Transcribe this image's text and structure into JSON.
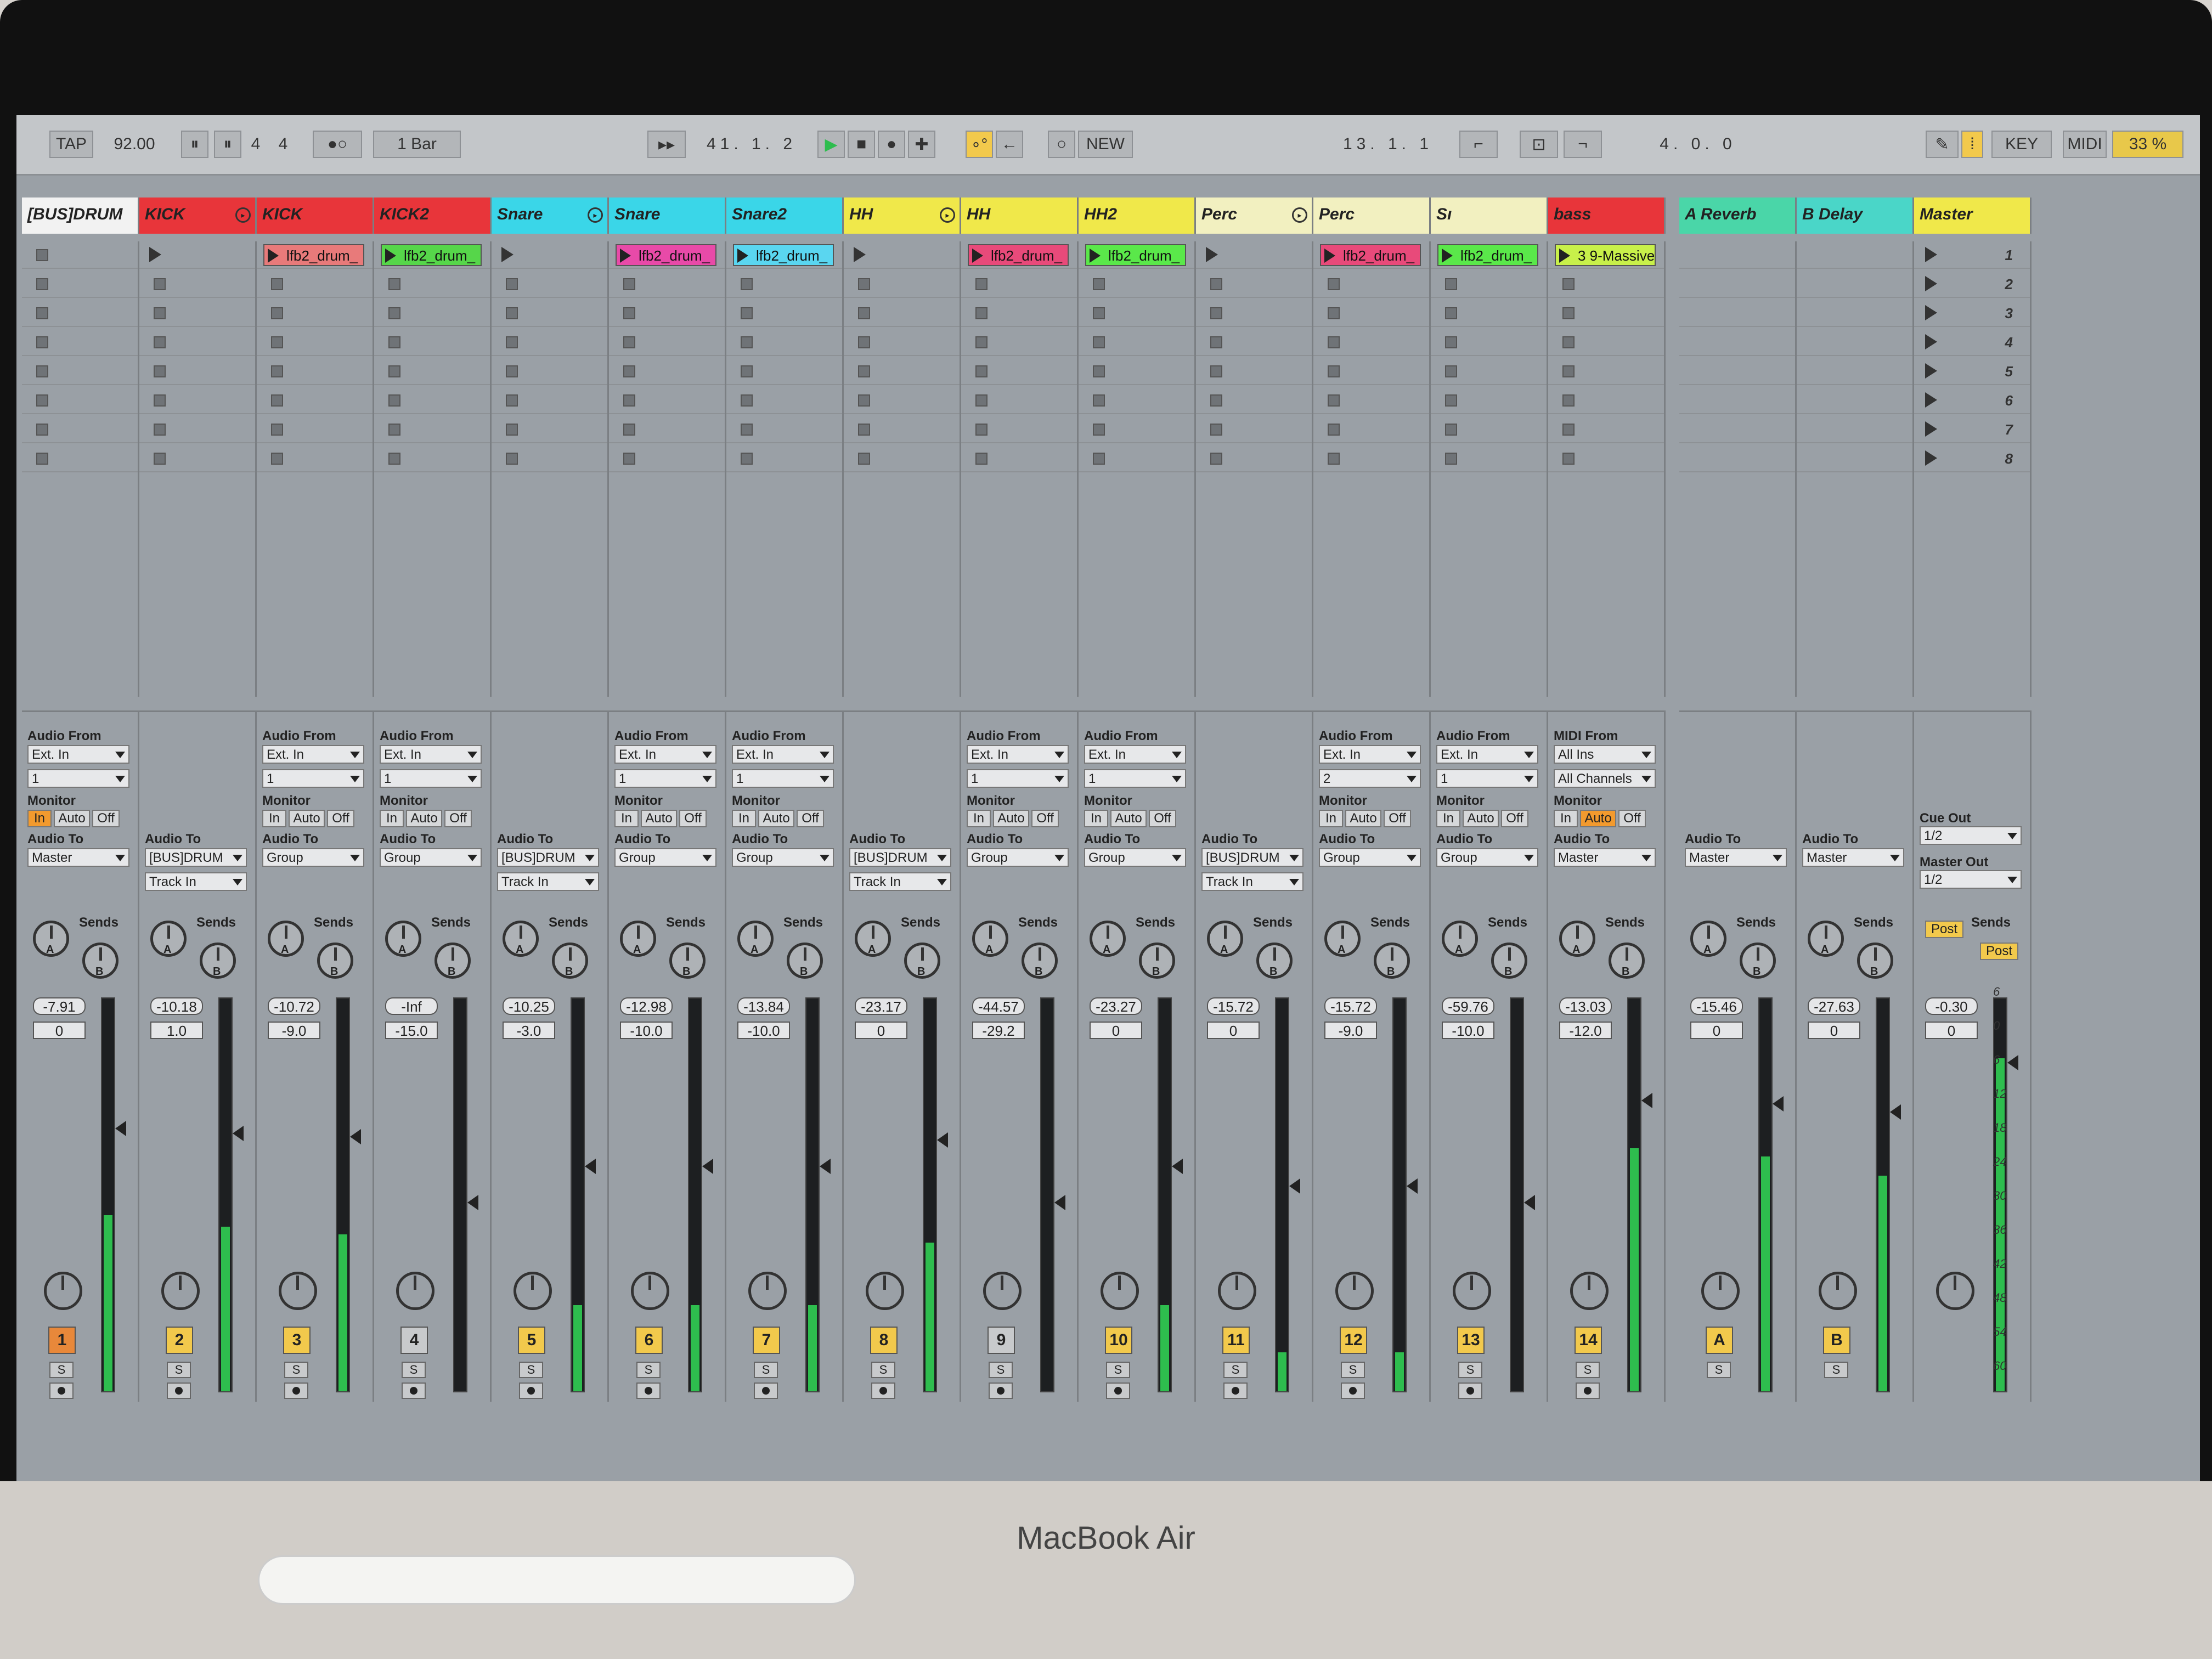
{
  "device": {
    "brand": "MacBook Air"
  },
  "transport": {
    "tap": "TAP",
    "tempo": "92.00",
    "sig_num": "4",
    "sig_den": "4",
    "quantize": "1 Bar",
    "position": "41. 1. 2",
    "new_label": "NEW",
    "loop_start": "13. 1. 1",
    "loop_length": "4. 0. 0",
    "key_label": "KEY",
    "midi_label": "MIDI",
    "cpu": "33 %"
  },
  "tracks": [
    {
      "name": "[BUS]DRUM",
      "color": "#f2f2f2",
      "clip": "",
      "clip_color": "",
      "audio_from": "Ext. In",
      "input_ch": "1",
      "monitor": "In",
      "audio_to": "Master",
      "track_in": "",
      "vol": "-7.91",
      "pan": "0",
      "num": "1",
      "num_color": "#e8883a",
      "meter": 0.45
    },
    {
      "name": "KICK",
      "color": "#e8353a",
      "clip": "",
      "clip_color": "",
      "audio_from": "",
      "input_ch": "",
      "monitor": "",
      "audio_to": "[BUS]DRUM",
      "track_in": "Track In",
      "vol": "-10.18",
      "pan": "1.0",
      "num": "2",
      "num_color": "#f2c94c",
      "meter": 0.42
    },
    {
      "name": "KICK",
      "color": "#e8353a",
      "clip": "lfb2_drum_",
      "clip_color": "#e87a7a",
      "audio_from": "Ext. In",
      "input_ch": "1",
      "monitor": "Auto",
      "audio_to": "Group",
      "track_in": "",
      "vol": "-10.72",
      "pan": "-9.0",
      "num": "3",
      "num_color": "#f2c94c",
      "meter": 0.4
    },
    {
      "name": "KICK2",
      "color": "#e8353a",
      "clip": "lfb2_drum_",
      "clip_color": "#56d64a",
      "audio_from": "Ext. In",
      "input_ch": "1",
      "monitor": "Auto",
      "audio_to": "Group",
      "track_in": "",
      "vol": "-Inf",
      "pan": "-15.0",
      "num": "4",
      "num_color": "#c8cacc",
      "meter": 0.0
    },
    {
      "name": "Snare",
      "color": "#3ad6e8",
      "clip": "",
      "clip_color": "",
      "audio_from": "",
      "input_ch": "",
      "monitor": "",
      "audio_to": "[BUS]DRUM",
      "track_in": "Track In",
      "vol": "-10.25",
      "pan": "-3.0",
      "num": "5",
      "num_color": "#f2c94c",
      "meter": 0.22
    },
    {
      "name": "Snare",
      "color": "#3ad6e8",
      "clip": "lfb2_drum_",
      "clip_color": "#e84aa8",
      "audio_from": "Ext. In",
      "input_ch": "1",
      "monitor": "Auto",
      "audio_to": "Group",
      "track_in": "",
      "vol": "-12.98",
      "pan": "-10.0",
      "num": "6",
      "num_color": "#f2c94c",
      "meter": 0.22
    },
    {
      "name": "Snare2",
      "color": "#3ad6e8",
      "clip": "lfb2_drum_",
      "clip_color": "#5ad6f0",
      "audio_from": "Ext. In",
      "input_ch": "1",
      "monitor": "Auto",
      "audio_to": "Group",
      "track_in": "",
      "vol": "-13.84",
      "pan": "-10.0",
      "num": "7",
      "num_color": "#f2c94c",
      "meter": 0.22
    },
    {
      "name": "HH",
      "color": "#f0e84a",
      "clip": "",
      "clip_color": "",
      "audio_from": "",
      "input_ch": "",
      "monitor": "",
      "audio_to": "[BUS]DRUM",
      "track_in": "Track In",
      "vol": "-23.17",
      "pan": "0",
      "num": "8",
      "num_color": "#f2c94c",
      "meter": 0.38
    },
    {
      "name": "HH",
      "color": "#f0e84a",
      "clip": "lfb2_drum_",
      "clip_color": "#e84a7a",
      "audio_from": "Ext. In",
      "input_ch": "1",
      "monitor": "Auto",
      "audio_to": "Group",
      "track_in": "",
      "vol": "-44.57",
      "pan": "-29.2",
      "num": "9",
      "num_color": "#c8cacc",
      "meter": 0.0
    },
    {
      "name": "HH2",
      "color": "#f0e84a",
      "clip": "lfb2_drum_",
      "clip_color": "#5ae84a",
      "audio_from": "Ext. In",
      "input_ch": "1",
      "monitor": "Auto",
      "audio_to": "Group",
      "track_in": "",
      "vol": "-23.27",
      "pan": "0",
      "num": "10",
      "num_color": "#f2c94c",
      "meter": 0.22
    },
    {
      "name": "Perc",
      "color": "#f2f0c0",
      "clip": "",
      "clip_color": "",
      "audio_from": "",
      "input_ch": "",
      "monitor": "",
      "audio_to": "[BUS]DRUM",
      "track_in": "Track In",
      "vol": "-15.72",
      "pan": "0",
      "num": "11",
      "num_color": "#f2c94c",
      "meter": 0.1
    },
    {
      "name": "Perc",
      "color": "#f2f0c0",
      "clip": "lfb2_drum_",
      "clip_color": "#e84a7a",
      "audio_from": "Ext. In",
      "input_ch": "2",
      "monitor": "Auto",
      "audio_to": "Group",
      "track_in": "",
      "vol": "-15.72",
      "pan": "-9.0",
      "num": "12",
      "num_color": "#f2c94c",
      "meter": 0.1
    },
    {
      "name": "Sı",
      "color": "#f2f0c0",
      "clip": "lfb2_drum_",
      "clip_color": "#5ae84a",
      "audio_from": "Ext. In",
      "input_ch": "1",
      "monitor": "Auto",
      "audio_to": "Group",
      "track_in": "",
      "vol": "-59.76",
      "pan": "-10.0",
      "num": "13",
      "num_color": "#f2c94c",
      "meter": 0.0
    },
    {
      "name": "bass",
      "color": "#e8353a",
      "clip": "3 9-Massive",
      "clip_color": "#c8f04a",
      "audio_from": "All Ins",
      "input_ch": "All Channels",
      "monitor": "Auto",
      "audio_to": "Master",
      "track_in": "",
      "vol": "-13.03",
      "pan": "-12.0",
      "num": "14",
      "num_color": "#f2c94c",
      "meter": 0.62
    }
  ],
  "labels": {
    "audio_from": "Audio From",
    "midi_from": "MIDI From",
    "monitor": "Monitor",
    "audio_to": "Audio To",
    "sends": "Sends",
    "send_a": "A",
    "send_b": "B",
    "mon_in": "In",
    "mon_auto": "Auto",
    "mon_off": "Off",
    "solo": "S",
    "cue_out": "Cue Out",
    "master_out": "Master Out",
    "post": "Post"
  },
  "returns": [
    {
      "name": "A Reverb",
      "color": "#4ad6a8",
      "audio_to": "Master",
      "vol": "-15.46",
      "pan": "0",
      "num": "A",
      "meter": 0.6
    },
    {
      "name": "B Delay",
      "color": "#4ad6c8",
      "audio_to": "Master",
      "vol": "-27.63",
      "pan": "0",
      "num": "B",
      "meter": 0.55
    }
  ],
  "master": {
    "name": "Master",
    "color": "#f0e84a",
    "cue_out": "1/2",
    "master_out": "1/2",
    "vol": "-0.30",
    "pan": "0",
    "scenes": [
      "1",
      "2",
      "3",
      "4",
      "5",
      "6",
      "7",
      "8"
    ],
    "meter": 0.85
  },
  "meter_scale": [
    "6",
    "0",
    "6",
    "12",
    "18",
    "24",
    "30",
    "36",
    "42",
    "48",
    "54",
    "60"
  ]
}
